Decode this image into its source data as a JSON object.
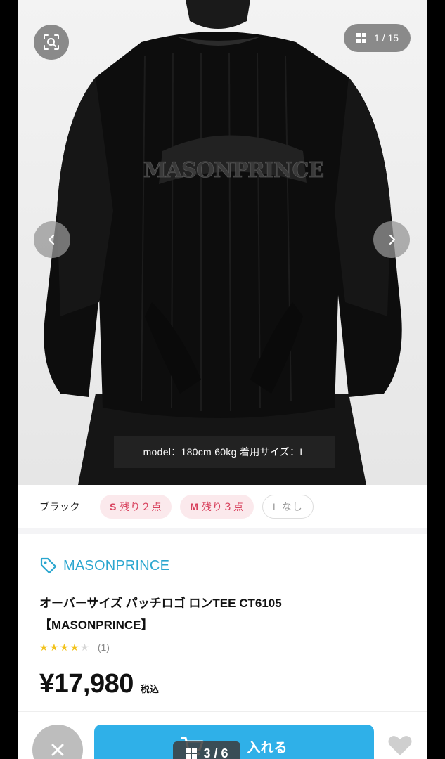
{
  "gallery": {
    "counter": "1 / 15",
    "model_caption": "model：180cm 60kg 着用サイズ：L",
    "shirt_print": "MASONPRINCE"
  },
  "color": {
    "label": "ブラック"
  },
  "sizes": [
    {
      "size": "S",
      "status": "残り２点"
    },
    {
      "size": "M",
      "status": "残り３点"
    },
    {
      "size": "L",
      "status": "なし"
    }
  ],
  "product": {
    "brand": "MASONPRINCE",
    "title_line1": "オーバーサイズ パッチロゴ ロンTEE CT6105",
    "title_line2": "【MASONPRINCE】",
    "rating": 4,
    "review_count": "(1)",
    "price": "¥17,980",
    "tax_label": "税込"
  },
  "actions": {
    "cart_label": "入れる",
    "page_indicator": "3 / 6"
  },
  "colors": {
    "accent": "#2fb0e8",
    "brand_link": "#2aa6cf",
    "stock_low": "#d8405c",
    "star": "#f2c21a"
  },
  "icons": [
    "search-lens-icon",
    "grid-icon",
    "chevron-left-icon",
    "chevron-right-icon",
    "tag-icon",
    "close-icon",
    "cart-icon",
    "heart-icon"
  ]
}
